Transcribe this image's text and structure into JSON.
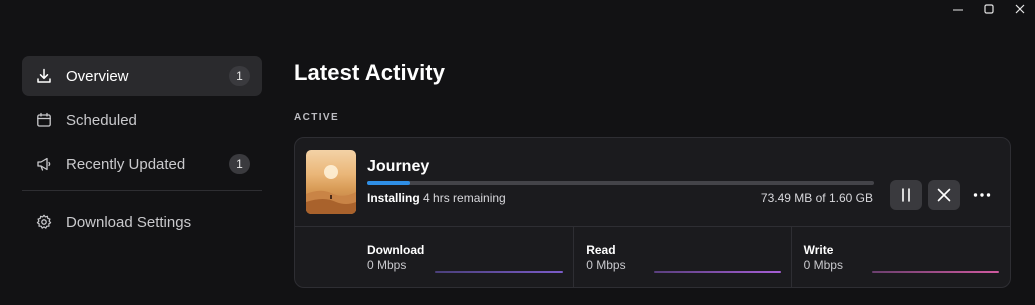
{
  "window": {
    "controls": [
      {
        "name": "minimize-icon"
      },
      {
        "name": "maximize-icon"
      },
      {
        "name": "close-icon"
      }
    ]
  },
  "sidebar": {
    "items": [
      {
        "label": "Overview",
        "icon": "download-icon",
        "badge": "1",
        "active": true
      },
      {
        "label": "Scheduled",
        "icon": "calendar-icon",
        "badge": "",
        "active": false
      },
      {
        "label": "Recently Updated",
        "icon": "megaphone-icon",
        "badge": "1",
        "active": false
      }
    ],
    "settings": {
      "label": "Download Settings",
      "icon": "gear-icon"
    }
  },
  "main": {
    "title": "Latest Activity",
    "section_label": "ACTIVE",
    "download": {
      "game_title": "Journey",
      "thumbnail": "journey-artwork",
      "progress": 0.085,
      "status": "Installing",
      "remaining": "4 hrs remaining",
      "size_text": "73.49 MB of 1.60 GB",
      "accent": "#2f8fe6",
      "actions": {
        "pause": "pause-icon",
        "cancel": "cancel-icon",
        "more": "more-icon"
      }
    },
    "stats": [
      {
        "label": "Download",
        "value": "0 Mbps"
      },
      {
        "label": "Read",
        "value": "0 Mbps"
      },
      {
        "label": "Write",
        "value": "0 Mbps"
      }
    ]
  }
}
